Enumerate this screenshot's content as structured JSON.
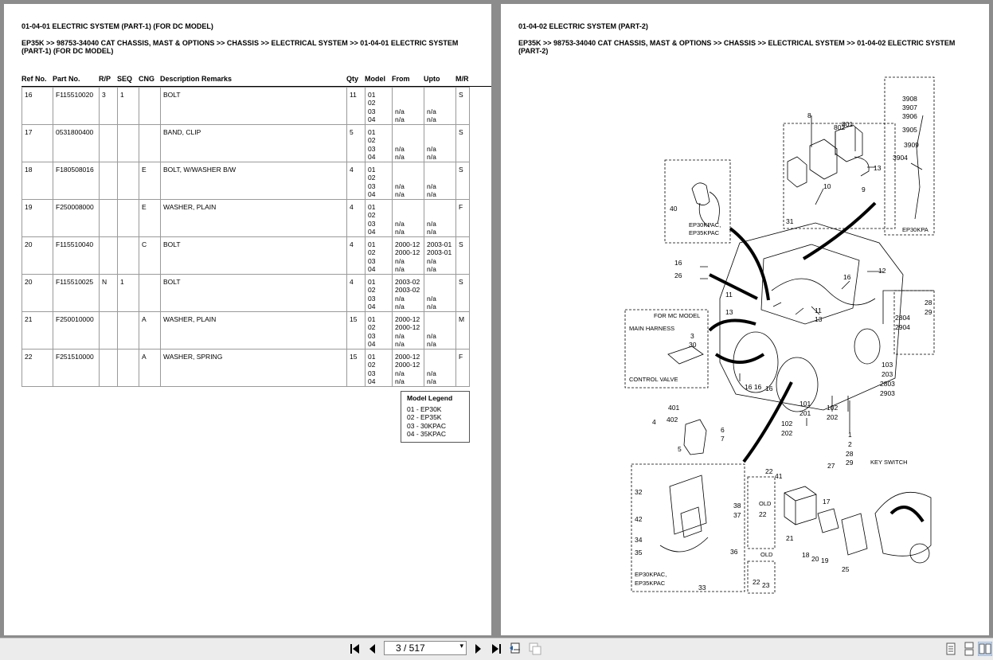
{
  "left_page": {
    "title": "01-04-01 ELECTRIC SYSTEM (PART-1) (FOR DC MODEL)",
    "breadcrumb_line1": "EP35K >> 98753-34040 CAT CHASSIS, MAST & OPTIONS >> CHASSIS >> ELECTRICAL SYSTEM >> 01-04-01 ELECTRIC SYSTEM",
    "breadcrumb_line2": "(PART-1) (FOR DC MODEL)",
    "columns": [
      "Ref No.",
      "Part No.",
      "R/P",
      "SEQ",
      "CNG",
      "Description Remarks",
      "Qty",
      "Model",
      "From",
      "Upto",
      "M/R"
    ],
    "rows": [
      {
        "ref": "16",
        "part": "F115510020",
        "rp": "3",
        "seq": "1",
        "cng": "",
        "desc": "BOLT",
        "qty": "11",
        "model": "01\n02\n03\n04",
        "from": "\n\nn/a\nn/a",
        "upto": "\n\nn/a\nn/a",
        "mr": "S"
      },
      {
        "ref": "17",
        "part": "0531800400",
        "rp": "",
        "seq": "",
        "cng": "",
        "desc": "BAND, CLIP",
        "qty": "5",
        "model": "01\n02\n03\n04",
        "from": "\n\nn/a\nn/a",
        "upto": "\n\nn/a\nn/a",
        "mr": "S"
      },
      {
        "ref": "18",
        "part": "F180508016",
        "rp": "",
        "seq": "",
        "cng": "E",
        "desc": "BOLT, W/WASHER B/W",
        "qty": "4",
        "model": "01\n02\n03\n04",
        "from": "\n\nn/a\nn/a",
        "upto": "\n\nn/a\nn/a",
        "mr": "S"
      },
      {
        "ref": "19",
        "part": "F250008000",
        "rp": "",
        "seq": "",
        "cng": "E",
        "desc": "WASHER, PLAIN",
        "qty": "4",
        "model": "01\n02\n03\n04",
        "from": "\n\nn/a\nn/a",
        "upto": "\n\nn/a\nn/a",
        "mr": "F"
      },
      {
        "ref": "20",
        "part": "F115510040",
        "rp": "",
        "seq": "",
        "cng": "C",
        "desc": "BOLT",
        "qty": "4",
        "model": "01\n02\n03\n04",
        "from": "2000-12\n2000-12\nn/a\nn/a",
        "upto": "2003-01\n2003-01\nn/a\nn/a",
        "mr": "S"
      },
      {
        "ref": "20",
        "part": "F115510025",
        "rp": "N",
        "seq": "1",
        "cng": "",
        "desc": "BOLT",
        "qty": "4",
        "model": "01\n02\n03\n04",
        "from": "2003-02\n2003-02\nn/a\nn/a",
        "upto": "\n\nn/a\nn/a",
        "mr": "S"
      },
      {
        "ref": "21",
        "part": "F250010000",
        "rp": "",
        "seq": "",
        "cng": "A",
        "desc": "WASHER, PLAIN",
        "qty": "15",
        "model": "01\n02\n03\n04",
        "from": "2000-12\n2000-12\nn/a\nn/a",
        "upto": "\n\nn/a\nn/a",
        "mr": "M"
      },
      {
        "ref": "22",
        "part": "F251510000",
        "rp": "",
        "seq": "",
        "cng": "A",
        "desc": "WASHER, SPRING",
        "qty": "15",
        "model": "01\n02\n03\n04",
        "from": "2000-12\n2000-12\nn/a\nn/a",
        "upto": "\n\nn/a\nn/a",
        "mr": "F"
      }
    ],
    "legend": {
      "title": "Model Legend",
      "items": [
        "01 - EP30K",
        "02 - EP35K",
        "03 - 30KPAC",
        "04 - 35KPAC"
      ]
    }
  },
  "right_page": {
    "title": "01-04-02 ELECTRIC SYSTEM (PART-2)",
    "breadcrumb_line1": "EP35K >> 98753-34040 CAT CHASSIS, MAST & OPTIONS >> CHASSIS >> ELECTRICAL SYSTEM >> 01-04-02 ELECTRIC SYSTEM",
    "breadcrumb_line2": "(PART-2)",
    "diagram_labels": {
      "for_mc_model": "FOR MC MODEL",
      "main_harness": "MAIN HARNESS",
      "control_valve": "CONTROL VALVE",
      "ep30kpac": "EP30KPAC,",
      "ep35kpac": "EP35KPAC",
      "ep30kpa_cut": "EP30KPA",
      "key_switch": "KEY SWITCH",
      "old": "OLD"
    }
  },
  "toolbar": {
    "page_indicator": "3 / 517"
  }
}
